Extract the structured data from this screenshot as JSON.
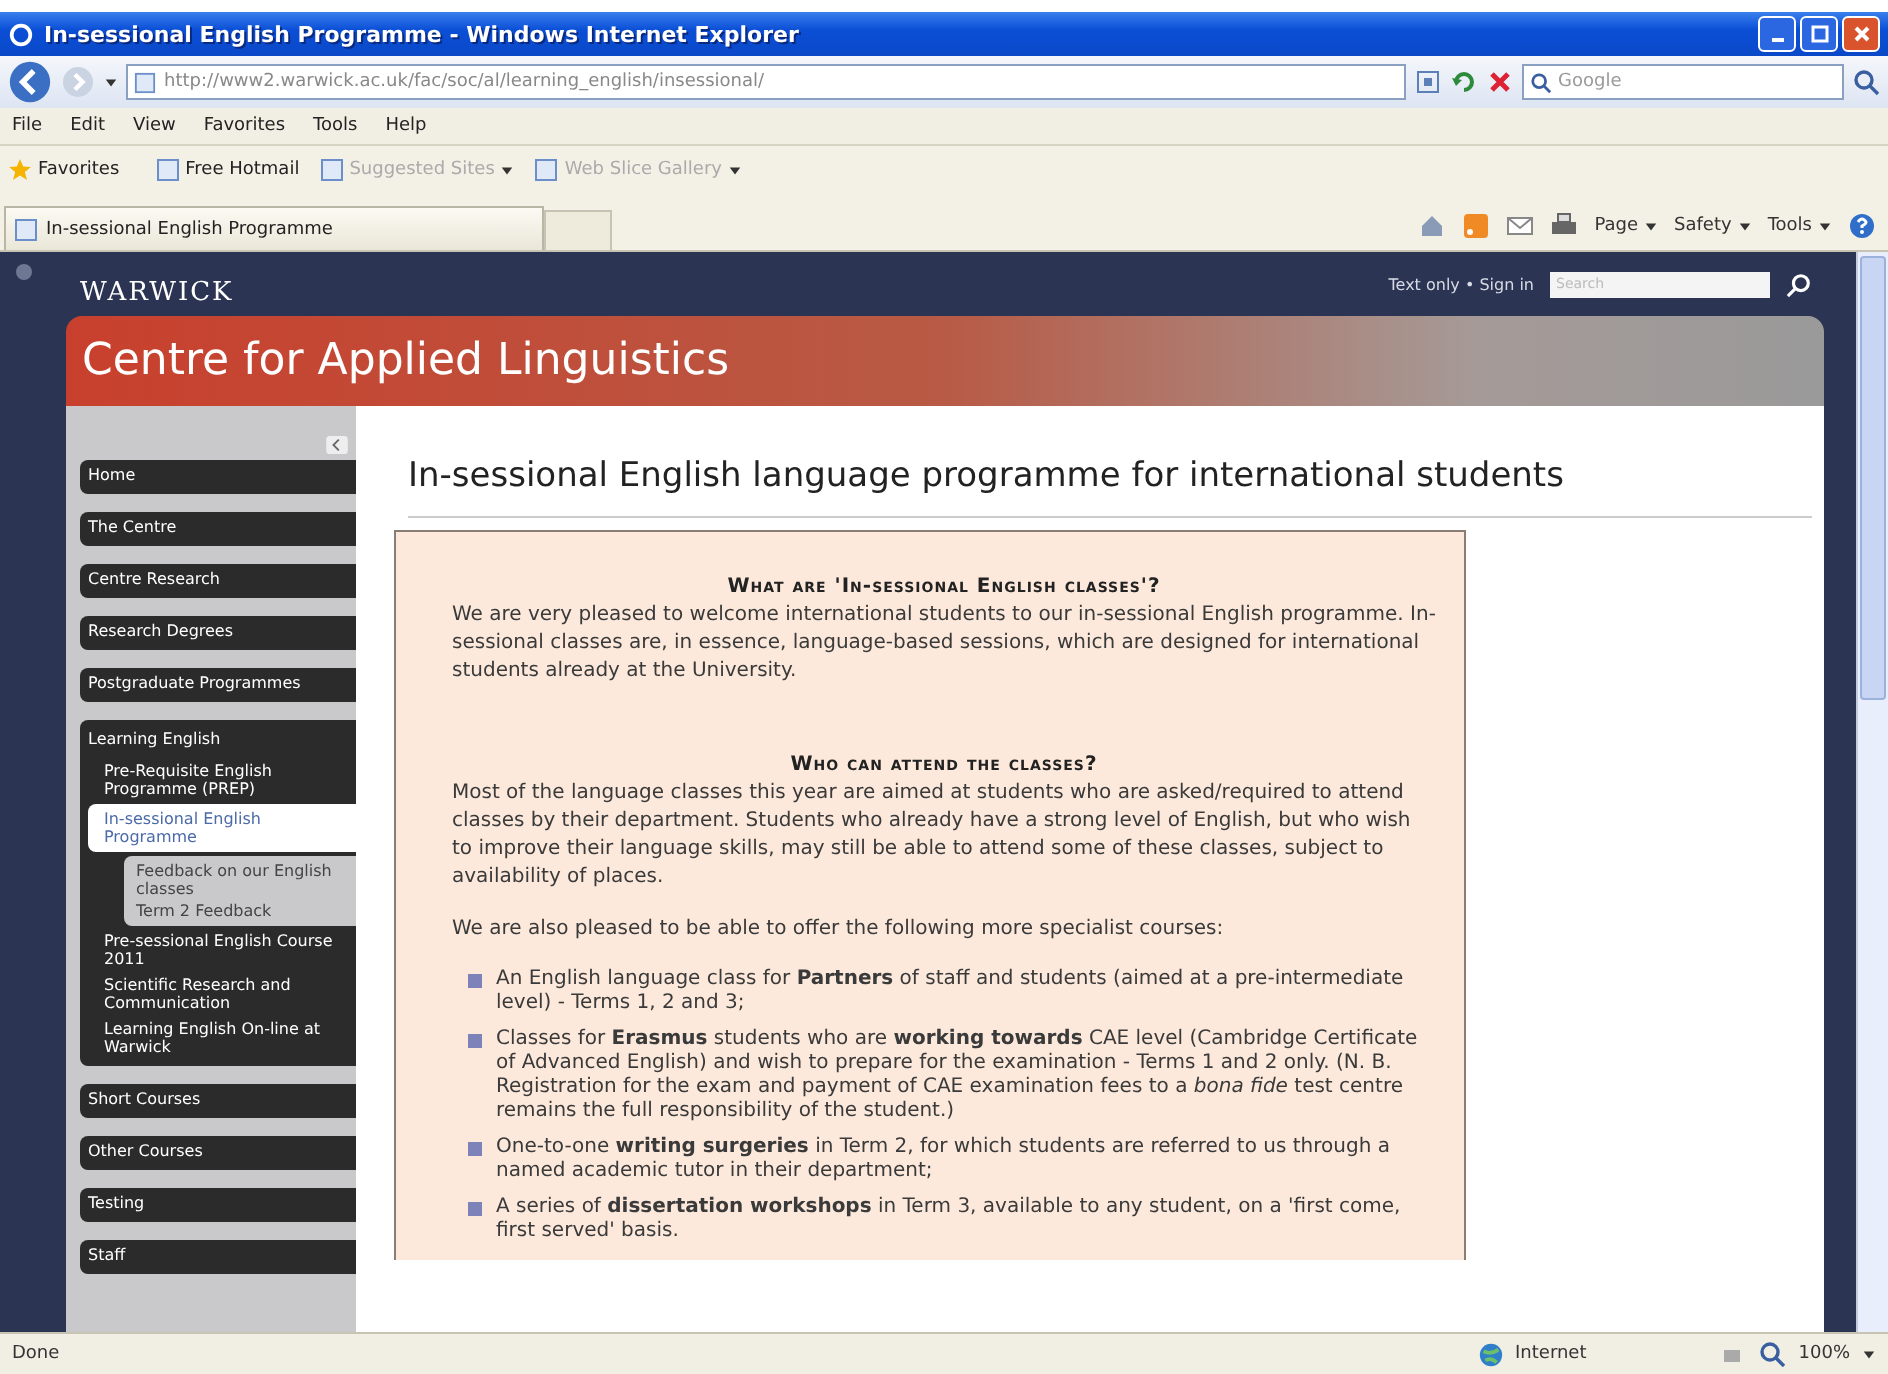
{
  "window": {
    "title": "In-sessional English Programme - Windows Internet Explorer"
  },
  "address_bar": {
    "url": "http://www2.warwick.ac.uk/fac/soc/al/learning_english/insessional/"
  },
  "search": {
    "placeholder": "Google"
  },
  "menu": [
    "File",
    "Edit",
    "View",
    "Favorites",
    "Tools",
    "Help"
  ],
  "favorites_bar": [
    {
      "label": "Favorites",
      "kind": "star"
    },
    {
      "label": "Free Hotmail",
      "kind": "link"
    },
    {
      "label": "Suggested Sites",
      "kind": "dropdown"
    },
    {
      "label": "Web Slice Gallery",
      "kind": "dropdown"
    }
  ],
  "tabs": [
    {
      "label": "In-sessional English Programme",
      "selected": true
    }
  ],
  "command_bar": [
    "Page",
    "Safety",
    "Tools"
  ],
  "site": {
    "logo": "WARWICK",
    "utility_links": "Text only • Sign in",
    "search_placeholder": "Search"
  },
  "department": "Centre for Applied Linguistics",
  "sidebar": {
    "items": [
      {
        "label": "Home",
        "selected": false
      },
      {
        "label": "The Centre",
        "selected": false
      },
      {
        "label": "Centre Research",
        "selected": false
      },
      {
        "label": "Research Degrees",
        "selected": false
      },
      {
        "label": "Postgraduate Programmes",
        "selected": false
      },
      {
        "label": "Learning English",
        "selected": false,
        "children": [
          {
            "label": "Pre-Requisite English Programme (PREP)",
            "selected": false
          },
          {
            "label": "In-sessional English Programme",
            "selected": true,
            "children": [
              {
                "label": "Feedback on our English classes",
                "selected": false
              },
              {
                "label": "Term 2 Feedback",
                "selected": false
              }
            ]
          },
          {
            "label": "Pre-sessional English Course 2011",
            "selected": false
          },
          {
            "label": "Scientific Research and Communication",
            "selected": false
          },
          {
            "label": "Learning English On-line at Warwick",
            "selected": false
          }
        ]
      },
      {
        "label": "Short Courses",
        "selected": false
      },
      {
        "label": "Other Courses",
        "selected": false
      },
      {
        "label": "Testing",
        "selected": false
      },
      {
        "label": "Staff",
        "selected": false
      }
    ]
  },
  "page_title": "In-sessional English language programme for international students",
  "sections": [
    {
      "heading": "What are 'In-sessional English classes'?",
      "blocks": [
        {
          "kind": "paragraph",
          "text": "We are very pleased to welcome international students to our in-sessional English programme. In-sessional classes are, in essence, language-based sessions, which are designed for international students already at the University."
        }
      ]
    },
    {
      "heading": "Who can attend the classes?",
      "blocks": [
        {
          "kind": "paragraph",
          "text": "Most of the language classes this year are aimed at students who are asked/required to attend classes by their department. Students who already have a strong level of English, but who wish to improve their language skills, may still be able to attend some of these classes, subject to availability of places."
        },
        {
          "kind": "paragraph",
          "text": "We are also pleased to be able to offer the following more specialist courses:"
        },
        {
          "kind": "list",
          "items": [
            "An English language class for **Partners** of staff and students (aimed at a pre-intermediate level) - Terms 1, 2 and 3;",
            "Classes for **Erasmus** students who are **working towards** CAE level (Cambridge Certificate of Advanced English) and wish to prepare for the examination - Terms 1 and 2 only. (N. B. Registration for the exam and payment of CAE examination fees to a *bona fide* test centre remains the full responsibility of the student.)",
            "One-to-one **writing surgeries** in Term 2, for which students are referred to us through a named academic tutor in their department;",
            "A series of **dissertation workshops** in Term 3, available to any student, on a 'first come, first served' basis."
          ]
        }
      ]
    }
  ],
  "status_bar": {
    "text": "Done",
    "zone": "Internet",
    "zoom": "100%"
  }
}
